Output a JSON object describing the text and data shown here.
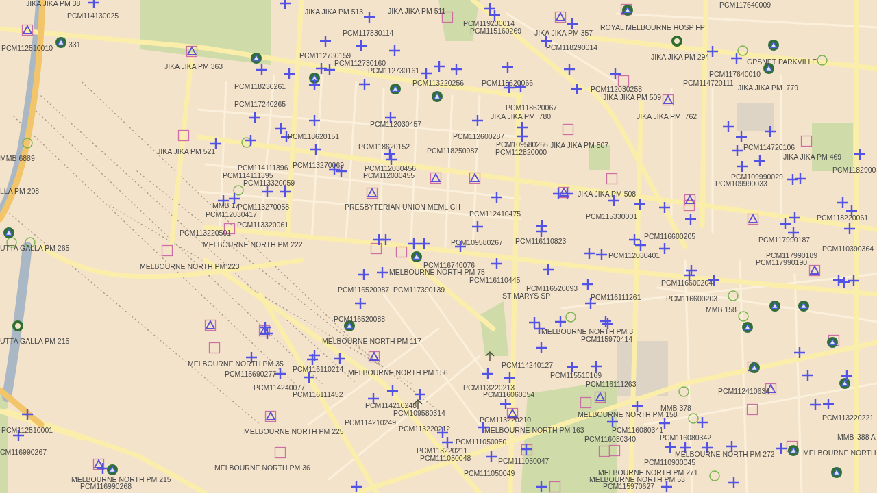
{
  "map": {
    "labels": [
      "JIKA JIKA PM 38",
      "PCM117640009",
      "JIKA JIKA PM 513",
      "JIKA JIKA PM 511",
      "PCM114130025",
      "PCM119230014",
      "ROYAL MELBOURNE HOSP FP",
      "PCM117830114",
      "PCM115160269",
      "JIKA JIKA PM 357",
      "PCM112510010",
      "331",
      "PCM118290014",
      "PCM112730159",
      "JIKA JIKA PM 294",
      "PCM112730160",
      "GPSNET PARKVILLE",
      "JIKA JIKA PM 363",
      "PCM112730161",
      "PCM117640010",
      "PCM118230261",
      "PCM113220256",
      "PCM118620066",
      "PCM114720111",
      "PCM112030258",
      "JIKA JIKA PM  779",
      "JIKA JIKA PM 509",
      "PCM117240265",
      "PCM118620067",
      "JIKA JIKA PM  780",
      "JIKA JIKA PM  762",
      "PCM112030457",
      "PCM118620151",
      "PCM112600287",
      "PCM118620152",
      "PCM109580266",
      "JIKA JIKA PM 507",
      "PCM114720106",
      "JIKA JIKA PM 521",
      "PCM118250987",
      "PCM112820000",
      "MMB 6889",
      "JIKA JIKA PM 469",
      "PCM114111396",
      "PCM113270069",
      "PCM112030456",
      "PCM1182900",
      "PCM114111395",
      "PCM112030455",
      "PCM109990029",
      "PCM113320059",
      "PCM109990033",
      "LLA PM 208",
      "JIKA JIKA PM 508",
      "MMB 17",
      "PCM113270058",
      "PRESBYTERIAN UNION MEML CH",
      "PCM112030417",
      "PCM112410475",
      "PCM115330001",
      "PCM118220061",
      "PCM113320061",
      "PCM113220501",
      "MELBOURNE NORTH PM 222",
      "PCM109580267",
      "PCM116110823",
      "PCM116600205",
      "PCM117990187",
      "UTTA GALLA PM 265",
      "PCM110390364",
      "PCM112030401",
      "PCM117990189",
      "MELBOURNE NORTH PM 223",
      "PCM116740076",
      "PCM117990190",
      "MELBOURNE NORTH PM 75",
      "PCM116110445",
      "PCM116600204",
      "PCM116520087",
      "PCM117390139",
      "PCM116520093",
      "ST MARYS SP",
      "PCM116111261",
      "PCM116600203",
      "MMB 158",
      "PCM116520088",
      "MELBOURNE NORTH PM 3",
      "UTTA GALLA PM 215",
      "MELBOURNE NORTH PM 117",
      "PCM115970414",
      "MELBOURNE NORTH PM 35",
      "PCM114240127",
      "PCM115690277",
      "PCM116110214",
      "MELBOURNE NORTH PM 156",
      "PCM115510169",
      "PCM116111263",
      "PCM114240077",
      "PCM113220213",
      "PCM112410634",
      "PCM116111452",
      "PCM116060054",
      "PCM114210248",
      "MMB 378",
      "PCM109580314",
      "MELBOURNE NORTH PM 158",
      "PCM113220210",
      "PCM113220221",
      "PCM114210249",
      "PCM112510001",
      "MELBOURNE NORTH PM 225",
      "PCM113220212",
      "MELBOURNE NORTH PM 163",
      "PCM116080341",
      "PCM116080340",
      "PCM116080342",
      "MMB",
      "388 A",
      "PCM111050050",
      "CM116990267",
      "PCM113220211",
      "MELBOURNE NORTH PM 272",
      "MELBOURNE NORTH",
      "PCM111050048",
      "PCM111050047",
      "PCM110930045",
      "MELBOURNE NORTH PM 36",
      "PCM111050049",
      "MELBOURNE NORTH PM 271",
      "MELBOURNE NORTH PM 215",
      "MELBOURNE NORTH PM 53",
      "PCM116990268",
      "PCM115970627"
    ]
  }
}
